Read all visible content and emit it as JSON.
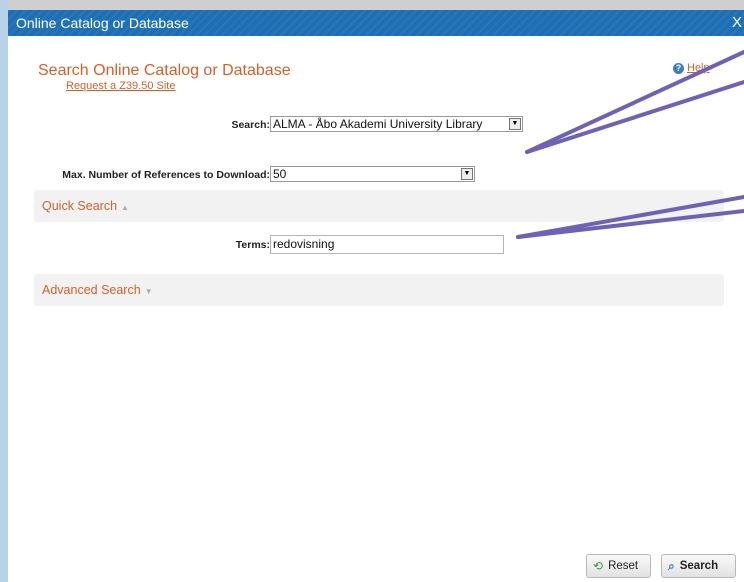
{
  "window": {
    "title": "Online Catalog or Database",
    "close_label": "X"
  },
  "page": {
    "heading": "Search Online Catalog or Database",
    "help_label": "Help",
    "request_link": "Request a Z39.50 Site"
  },
  "form": {
    "search_label": "Search:",
    "search_value": "ALMA - Åbo Akademi University Library",
    "max_refs_label": "Max. Number of References to Download:",
    "max_refs_value": "50"
  },
  "quick_search": {
    "title": "Quick Search",
    "terms_label": "Terms:",
    "terms_value": "redovisning"
  },
  "advanced_search": {
    "title": "Advanced Search"
  },
  "buttons": {
    "reset": "Reset",
    "search": "Search"
  },
  "colors": {
    "titlebar": "#1d6fb4",
    "accent": "#d4612b",
    "callout": "#6e62b6"
  }
}
